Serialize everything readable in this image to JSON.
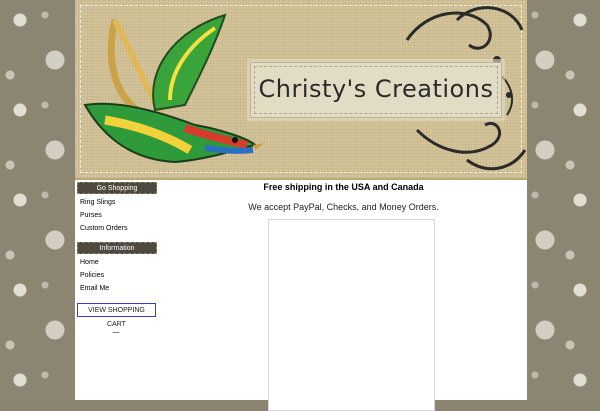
{
  "site": {
    "title": "Christy's Creations"
  },
  "sidebar": {
    "shop_header": "Go Shopping",
    "shop_items": [
      "Ring Slings",
      "Purses",
      "Custom Orders"
    ],
    "info_header": "Information",
    "info_items": [
      "Home",
      "Policies",
      "Email Me"
    ],
    "cart_button": "VIEW SHOPPING CART",
    "footer_mark": "—"
  },
  "main": {
    "shipping_notice": "Free shipping in the USA and Canada",
    "payment_notice": "We accept PayPal, Checks, and Money Orders."
  },
  "colors": {
    "background": "#8b8572",
    "header_burlap": "#d4c49a",
    "sidebar_header": "#4e4a40",
    "cart_border": "#3b3bd0"
  }
}
